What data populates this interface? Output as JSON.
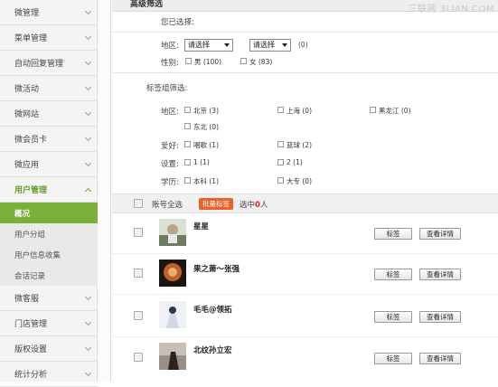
{
  "sidebar": {
    "items": [
      {
        "label": "微管理"
      },
      {
        "label": "菜单管理"
      },
      {
        "label": "自动回复管理"
      },
      {
        "label": "微活动"
      },
      {
        "label": "微网站"
      },
      {
        "label": "微会员卡"
      },
      {
        "label": "微应用"
      },
      {
        "label": "用户管理"
      },
      {
        "label": "微客服"
      },
      {
        "label": "门店管理"
      },
      {
        "label": "版权设置"
      },
      {
        "label": "统计分析"
      }
    ],
    "sub_items": [
      {
        "label": "概况"
      },
      {
        "label": "用户分组"
      },
      {
        "label": "用户信息收集"
      },
      {
        "label": "会话记录"
      }
    ]
  },
  "filter": {
    "header": "高级筛选",
    "watermark": "三联网 3LIAN.COM",
    "selected_label": "您已选择:",
    "region_label": "地区:",
    "region_select_1": "请选择",
    "region_select_2": "请选择",
    "region_count": "(0)",
    "gender_label": "性别:",
    "gender_options": [
      {
        "label": "男 (100)"
      },
      {
        "label": "女 (83)"
      }
    ],
    "tag_group_label": "标签组筛选:",
    "tag_region_label": "地区:",
    "tag_region_options": [
      {
        "label": "北京 (3)"
      },
      {
        "label": "上海 (0)"
      },
      {
        "label": "黑龙江 (0)"
      },
      {
        "label": "东北 (0)"
      }
    ],
    "hobby_label": "爱好:",
    "hobby_options": [
      {
        "label": "唱歌 (1)"
      },
      {
        "label": "篮球 (2)"
      }
    ],
    "setting_label": "设置:",
    "setting_options": [
      {
        "label": "1 (1)"
      },
      {
        "label": "2 (1)"
      }
    ],
    "education_label": "学历:",
    "education_options": [
      {
        "label": "本科 (1)"
      },
      {
        "label": "大专 (0)"
      }
    ]
  },
  "list": {
    "select_all_label": "账号全选",
    "batch_tag_label": "批量标签",
    "selected_prefix": "选中",
    "selected_count": "0",
    "selected_suffix": "人",
    "tag_button_label": "标签",
    "detail_button_label": "查看详情",
    "users": [
      {
        "name": "星星"
      },
      {
        "name": "果之萧～张强"
      },
      {
        "name": "毛毛@领拓"
      },
      {
        "name": "北纹孙立宏"
      }
    ]
  },
  "colors": {
    "accent_green": "#78b03a",
    "batch_orange": "#e8622a",
    "count_red": "#e02020"
  }
}
